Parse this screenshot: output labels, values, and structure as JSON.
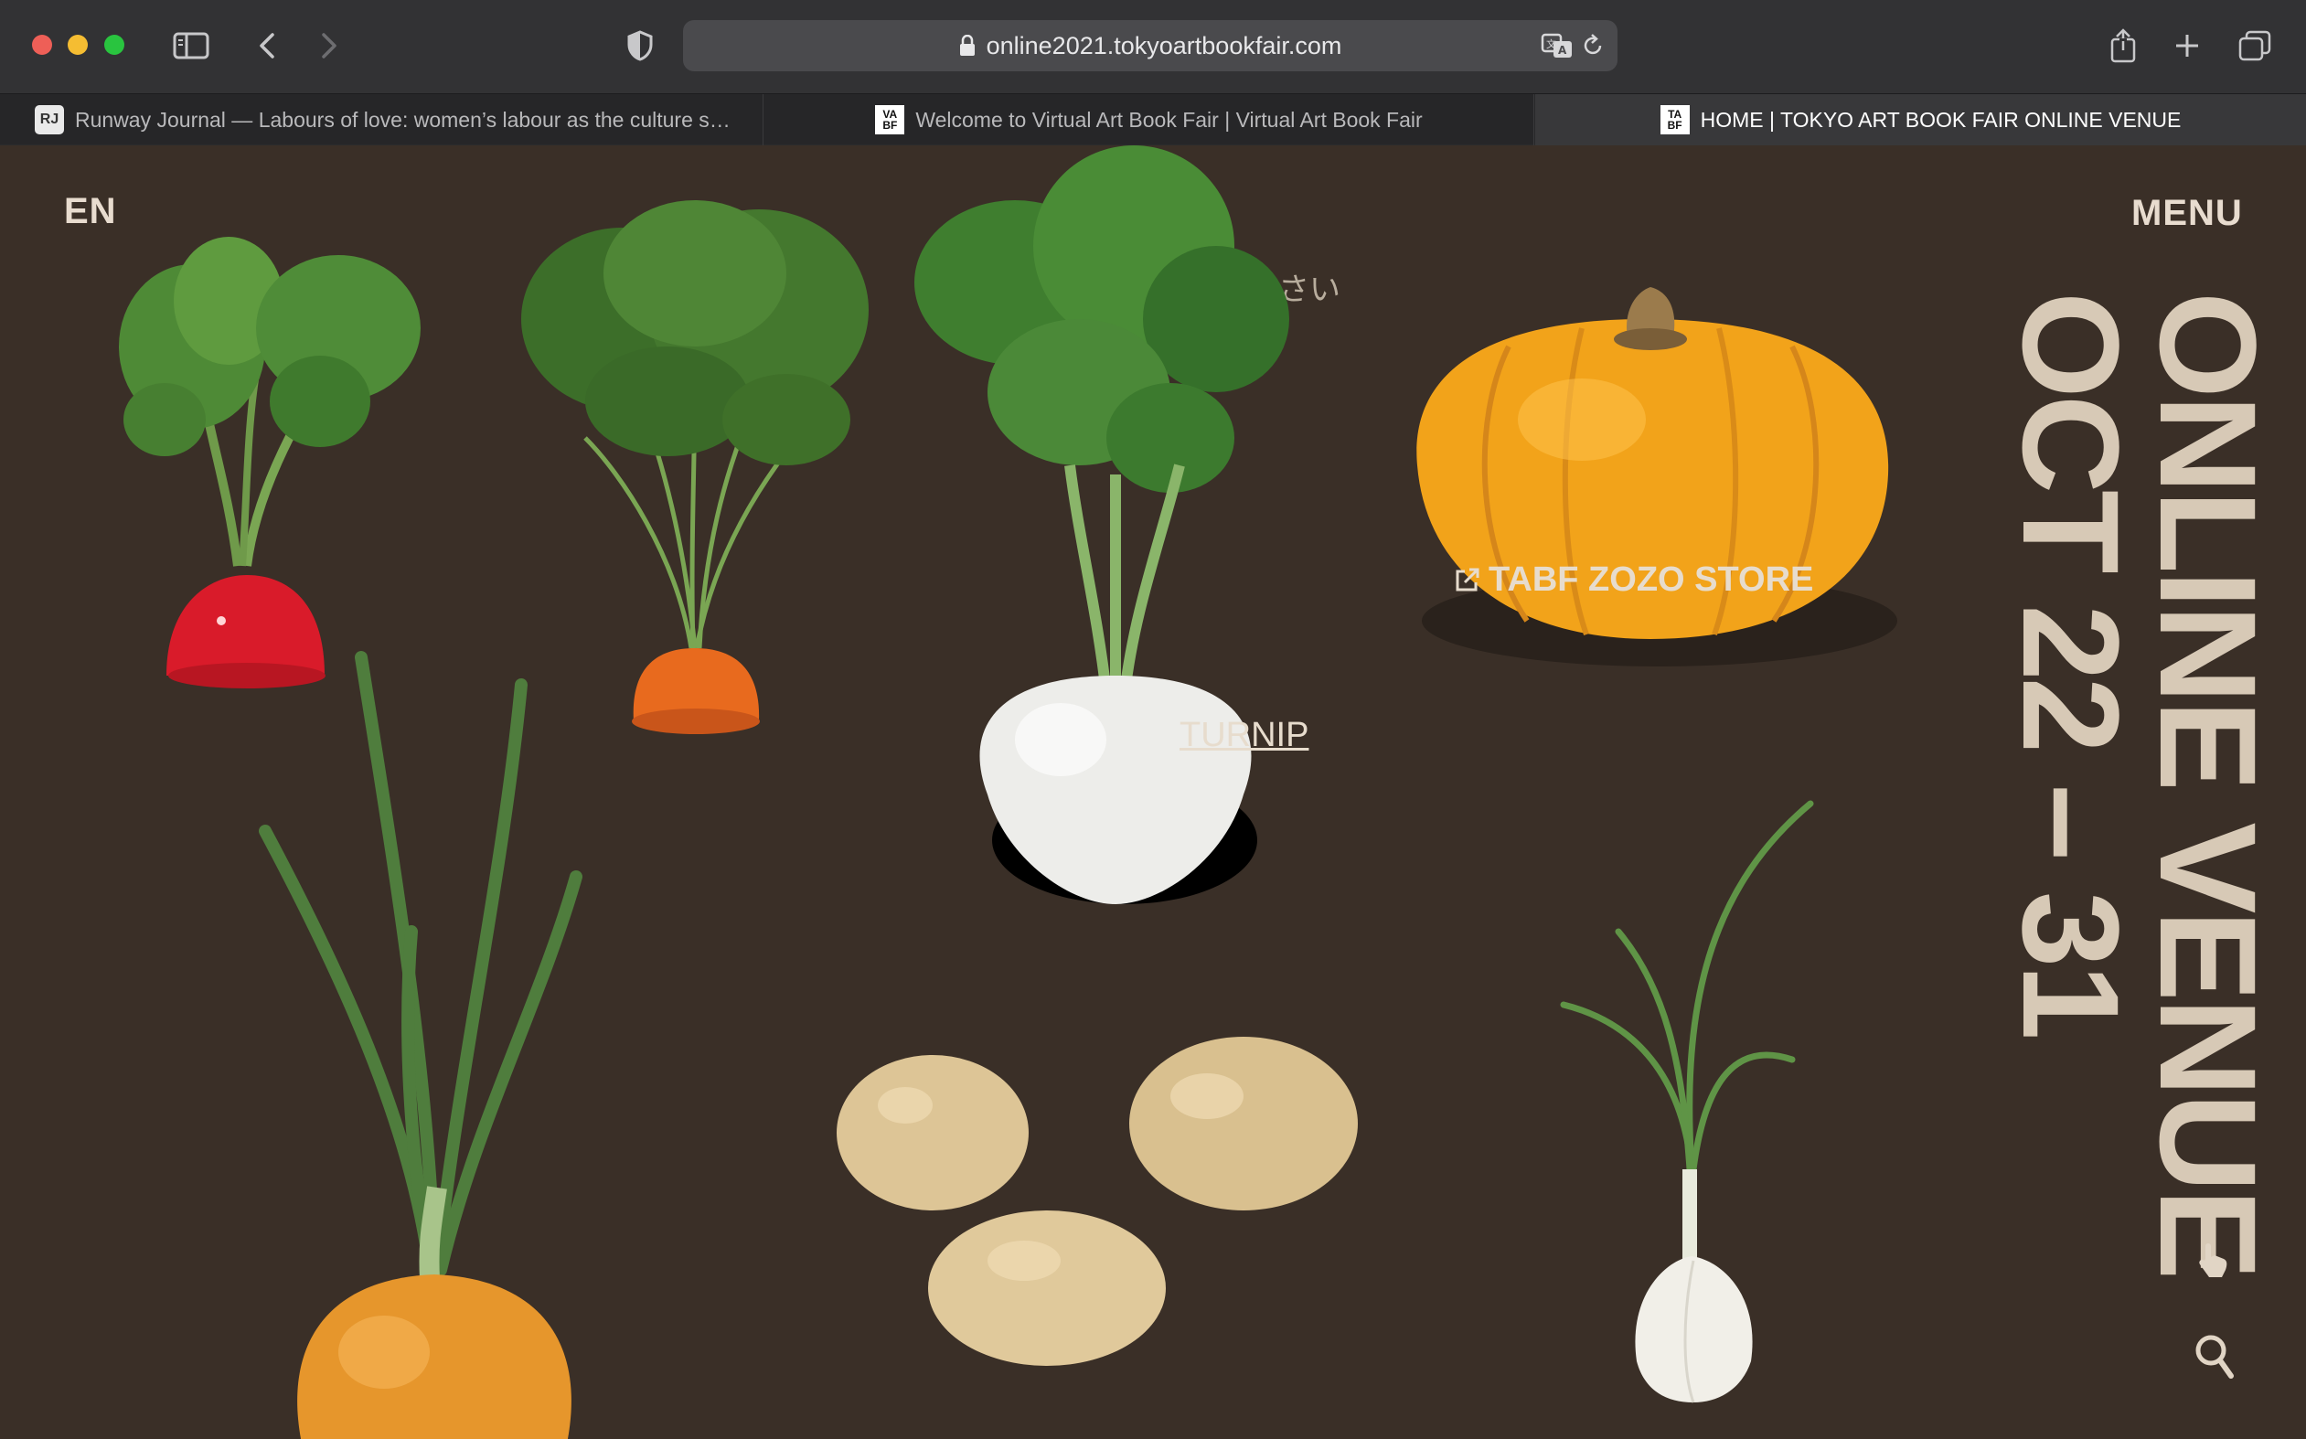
{
  "browser": {
    "url": "online2021.tokyoartbookfair.com",
    "tabs": [
      {
        "favicon": "RJ",
        "title": "Runway Journal — Labours of love: women’s labour as the culture s…"
      },
      {
        "favicon_top": "VA",
        "favicon_bottom": "BF",
        "title": "Welcome to Virtual Art Book Fair | Virtual Art Book Fair"
      },
      {
        "favicon_top": "TA",
        "favicon_bottom": "BF",
        "title": "HOME | TOKYO ART BOOK FAIR ONLINE VENUE",
        "active": true
      }
    ],
    "icons": [
      "sidebar-icon",
      "back-icon",
      "forward-icon",
      "privacy-shield-icon",
      "lock-icon",
      "translate-icon",
      "reload-icon",
      "share-icon",
      "new-tab-icon",
      "tab-overview-icon"
    ]
  },
  "page": {
    "lang": "EN",
    "menu": "MENU",
    "headline": {
      "line1": "ONLINE VENUE",
      "line2": "OCT 22 – 31"
    },
    "japanese_text": "ス　　　　　　　　　ださい",
    "links": {
      "turnip": "TURNIP",
      "store": "TABF ZOZO STORE"
    },
    "background": "#3a2f27",
    "accent_text": "#d7c9b6",
    "vegetables": [
      "radish",
      "carrot",
      "turnip",
      "pumpkin",
      "onion",
      "potatoes",
      "garlic"
    ]
  }
}
